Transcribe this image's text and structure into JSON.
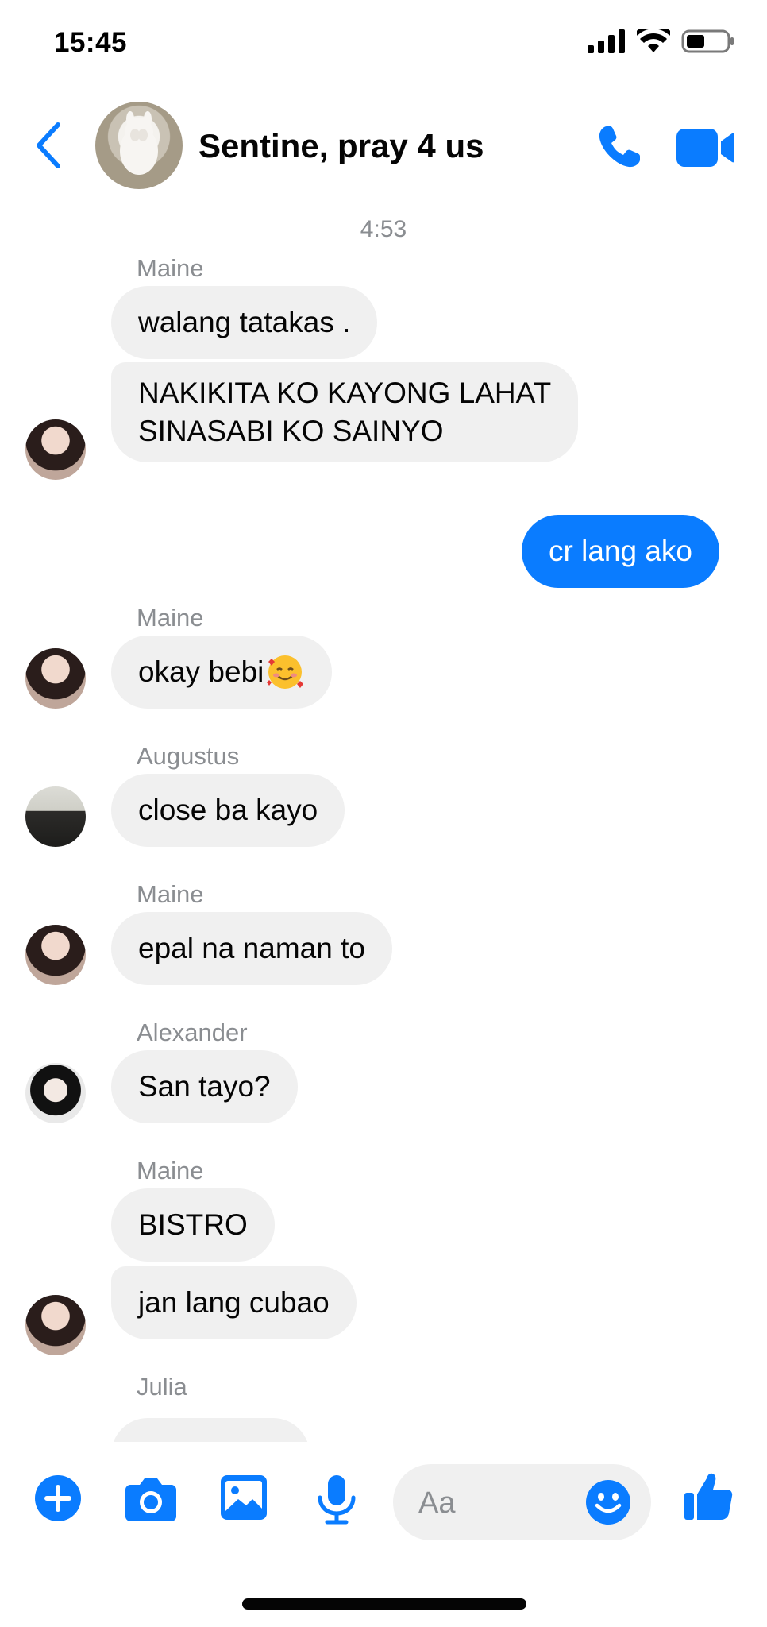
{
  "status_bar": {
    "time": "15:45"
  },
  "header": {
    "title": "Sentine, pray 4 us"
  },
  "thread": {
    "timestamp": "4:53",
    "messages": [
      {
        "sender": "Maine",
        "text": "walang tatakas ."
      },
      {
        "text": "NAKIKITA KO KAYONG LAHAT\nSINASABI KO SAINYO"
      },
      {
        "text": "cr lang ako",
        "mine": true
      },
      {
        "sender": "Maine",
        "text": "okay bebi"
      },
      {
        "sender": "Augustus",
        "text": "close ba kayo"
      },
      {
        "sender": "Maine",
        "text": "epal na naman to"
      },
      {
        "sender": "Alexander",
        "text": "San tayo?"
      },
      {
        "sender": "Maine",
        "text": "BISTRO"
      },
      {
        "text": "jan lang cubao"
      },
      {
        "sender": "Julia"
      }
    ]
  },
  "composer": {
    "placeholder": "Aa"
  },
  "colors": {
    "accent": "#0a7cff",
    "bubble_gray": "#f0f0f0",
    "meta_text": "#8a8d91"
  },
  "icons": [
    "signal-icon",
    "wifi-icon",
    "battery-icon",
    "back-chevron-icon",
    "phone-icon",
    "video-camera-icon",
    "plus-icon",
    "camera-icon",
    "gallery-icon",
    "microphone-icon",
    "emoji-icon",
    "thumbs-up-icon"
  ]
}
